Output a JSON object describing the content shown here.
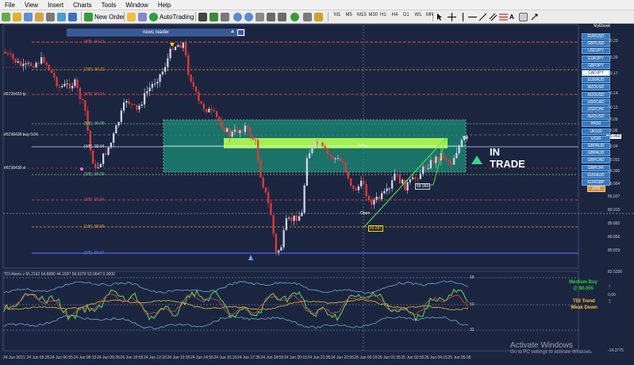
{
  "menu": [
    "File",
    "View",
    "Insert",
    "Charts",
    "Tools",
    "Window",
    "Help"
  ],
  "toolbar": {
    "new_order": "New Order",
    "autotrading": "AutoTrading",
    "timeframes": [
      "M1",
      "M5",
      "M15",
      "M30",
      "H1",
      "H4",
      "D1",
      "W1",
      "MN"
    ]
  },
  "news_reader": {
    "label": "news reader",
    "button": "▲"
  },
  "price_axis": [
    "90.23",
    "90.20",
    "90.17",
    "90.14",
    "90.12",
    "90.09",
    "90.06",
    "90.04",
    "90.031",
    "89.990",
    "89.964",
    "89.937",
    "89.910",
    "89.883",
    "89.856",
    "89.829",
    "82.5336",
    "0.00",
    "-14.3775"
  ],
  "current_price": "90.053",
  "time_axis": [
    "24 Jun 2021",
    "24 Jun 05:35",
    "24 Jun 06:55",
    "24 Jun 08:15",
    "24 Jun 09:35",
    "24 Jun 10:55",
    "24 Jun 12:15",
    "24 Jun 13:35",
    "24 Jun 14:55",
    "24 Jun 16:15",
    "24 Jun 17:35",
    "24 Jun 18:55",
    "24 Jun 20:15",
    "24 Jun 21:35",
    "24 Jun 22:55",
    "25 Jun 00:15",
    "25 Jun 01:35",
    "25 Jun 02:55",
    "25 Jun 04:15",
    "25 Jun 05:35"
  ],
  "murrey_levels": [
    {
      "label": "[8/8]",
      "value": "90.23"
    },
    {
      "label": "[7/8]",
      "value": "90.19"
    },
    {
      "label": "[6/8]",
      "value": "90.14"
    },
    {
      "label": "[5/8]",
      "value": "90.09"
    },
    {
      "label": "[4/8]",
      "value": "90.04"
    },
    {
      "label": "[3/8]",
      "value": "89.99"
    },
    {
      "label": "[2/8]",
      "value": "89.94"
    },
    {
      "label": "[1/8]",
      "value": "89.89"
    },
    {
      "label": "[0/8]",
      "value": "89.84"
    }
  ],
  "left_labels": [
    "#6726423 tp",
    "#6726428 buy 0.04",
    "#6726428 sl"
  ],
  "zone_labels": {
    "today": "Today",
    "open": "Open"
  },
  "price_boxes": [
    "89.966",
    "89.887"
  ],
  "symbol_panel": {
    "title": "MyEbook",
    "symbols": [
      "EURUSD",
      "GBPUSD",
      "USDJPY",
      "EURJPY",
      "GBPJPY",
      "CADJPY",
      "EURAUD",
      "NZDUSD",
      "AUDUSD",
      "USDCAD",
      "USDCHF",
      "AUDUSD",
      "HK50",
      "UK100",
      "US30",
      "GBPAUD",
      "GBPAUD",
      "GBPCAD",
      "GBPCHF",
      "EURAUD",
      "EURGBP"
    ],
    "active": "CADJPY",
    "atr": "ATR"
  },
  "trade_signal": {
    "line1": "IN",
    "line2": "TRADE"
  },
  "tdi": {
    "title": "TDI Alerts v 65.2162 54.6880 44.1597 58.6376 53.0647 0.0000",
    "levels": [
      "68",
      "50",
      "32"
    ],
    "status1": "Medium Buy",
    "status1_value": "@ 90.055",
    "status2": "TDI Trend",
    "status2_value": "Weak Down"
  },
  "watermark": {
    "title": "Activate Windows",
    "subtitle": "Go to PC settings to activate Windows."
  },
  "colors": {
    "background": "#1c2540",
    "bull": "#cfd6e6",
    "bear": "#e23b3b",
    "zone": "#1a9079",
    "highlight": "#b8ff50"
  }
}
